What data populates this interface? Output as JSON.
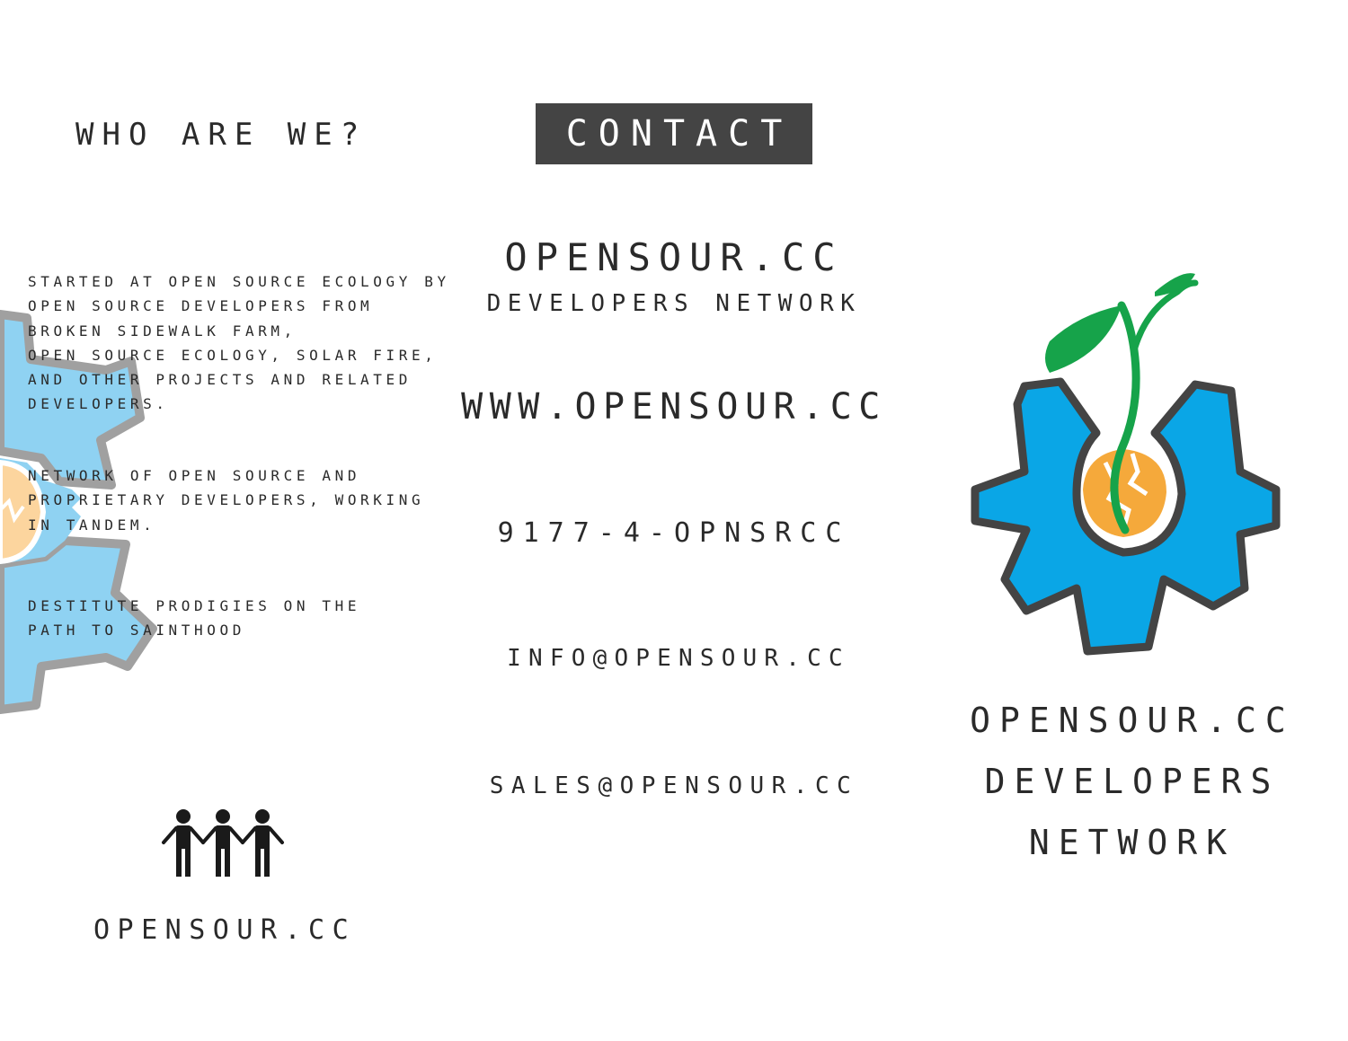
{
  "left_panel": {
    "title": "WHO ARE WE?",
    "paragraph_1": [
      "STARTED AT OPEN SOURCE ECOLOGY BY",
      "OPEN SOURCE DEVELOPERS FROM",
      "BROKEN SIDEWALK FARM,",
      "OPEN SOURCE ECOLOGY, SOLAR FIRE,",
      "AND OTHER PROJECTS AND RELATED",
      "DEVELOPERS."
    ],
    "paragraph_2": [
      "NETWORK OF OPEN SOURCE AND",
      "PROPRIETARY DEVELOPERS, WORKING",
      "IN TANDEM."
    ],
    "paragraph_3": [
      "DESTITUTE PRODIGIES ON THE",
      "PATH TO SAINTHOOD"
    ],
    "people_icon": "three-people-holding-hands-icon",
    "site": "OPENSOUR.CC"
  },
  "middle_panel": {
    "header": "CONTACT",
    "brand": "OPENSOUR.CC",
    "subtitle": "DEVELOPERS NETWORK",
    "website": "WWW.OPENSOUR.CC",
    "phone": "9177-4-OPNSRCC",
    "info_email": "INFO@OPENSOUR.CC",
    "sales_email": "SALES@OPENSOUR.CC"
  },
  "right_panel": {
    "logo_icon": "gear-seedling-logo-icon",
    "title_lines": [
      "OPENSOUR.CC",
      "DEVELOPERS",
      "NETWORK"
    ]
  },
  "colors": {
    "gear_blue": "#0aa6e6",
    "gear_outline": "#444444",
    "leaf_green": "#16a34a",
    "seed_orange": "#f5a93b",
    "contact_box": "#444444",
    "faded_gear_blue": "#8fd2f2",
    "faded_gear_outline": "#a0a0a0",
    "faded_seed": "#fcd59e"
  }
}
